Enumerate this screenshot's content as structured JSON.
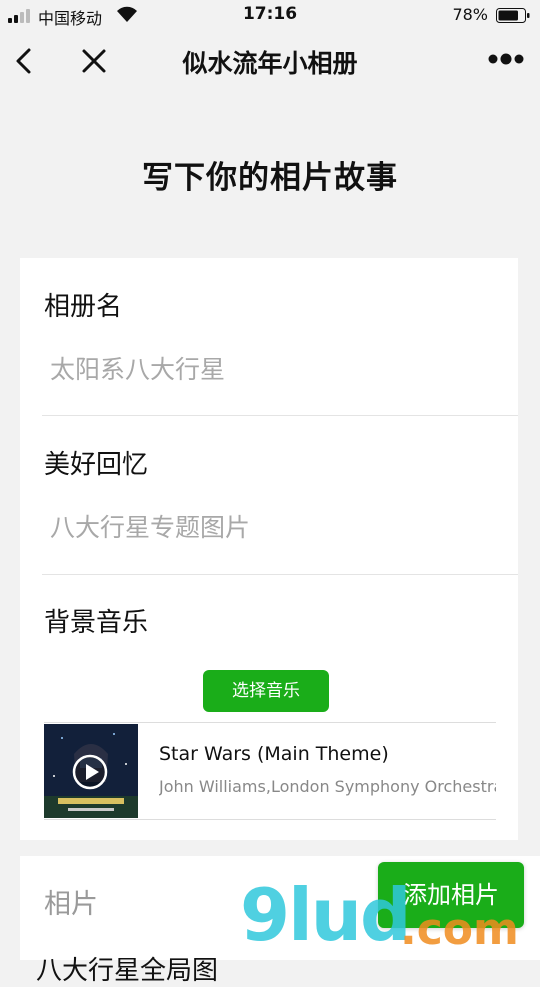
{
  "status_bar": {
    "carrier": "中国移动",
    "time": "17:16",
    "battery_percent": "78%",
    "battery_level": 0.78
  },
  "nav": {
    "title": "似水流年小相册",
    "back_icon": "chevron-left-icon",
    "close_icon": "close-icon",
    "more_icon": "more-dots-icon"
  },
  "heading": "写下你的相片故事",
  "form": {
    "album_name": {
      "label": "相册名",
      "value": "太阳系八大行星"
    },
    "memory": {
      "label": "美好回忆",
      "value": "八大行星专题图片"
    },
    "music": {
      "label": "背景音乐",
      "select_button": "选择音乐",
      "song_title": "Star Wars (Main Theme)",
      "song_artist": "John Williams,London Symphony Orchestra",
      "cover_icon": "album-cover-icon",
      "play_icon": "play-icon"
    }
  },
  "photos": {
    "label": "相片",
    "item_text": "八大行星全局图",
    "add_button": "添加相片"
  },
  "watermark": {
    "text": "9lud",
    "suffix": ".com"
  },
  "colors": {
    "accent_green": "#1aad19",
    "background": "#f2f2f2",
    "placeholder_gray": "#a8a8a8"
  }
}
